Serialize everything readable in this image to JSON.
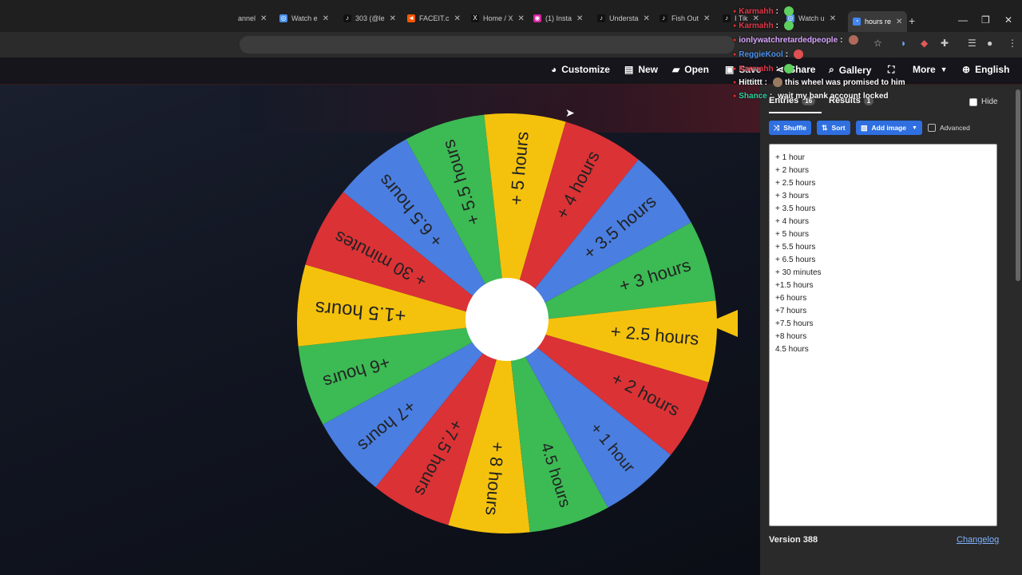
{
  "browser": {
    "tabs": [
      {
        "label": "annel",
        "favicon": "",
        "color": "#888888"
      },
      {
        "label": "Watch e",
        "favicon": "globe",
        "color": "#4a8fe8"
      },
      {
        "label": "303 (@le",
        "favicon": "tiktok",
        "color": "#111111"
      },
      {
        "label": "FACEIT.c",
        "favicon": "faceit",
        "color": "#ff5500"
      },
      {
        "label": "Home / X",
        "favicon": "x",
        "color": "#111111"
      },
      {
        "label": "(1) Insta",
        "favicon": "instagram",
        "color": "#d6249f"
      },
      {
        "label": "Understa",
        "favicon": "tiktok",
        "color": "#111111"
      },
      {
        "label": "Fish Out",
        "favicon": "tiktok",
        "color": "#111111"
      },
      {
        "label": "I Tik",
        "favicon": "tiktok",
        "color": "#111111"
      },
      {
        "label": "Watch u",
        "favicon": "globe",
        "color": "#4a8fe8"
      },
      {
        "label": "hours re",
        "favicon": "wheel",
        "color": "#4285f4",
        "active": true
      }
    ],
    "new_tab": "+",
    "controls": {
      "minimize": "—",
      "maximize": "❐",
      "close": "✕"
    }
  },
  "app_nav": {
    "customize": "Customize",
    "new": "New",
    "open": "Open",
    "save": "Save",
    "share": "Share",
    "gallery": "Gallery",
    "more": "More",
    "language": "English"
  },
  "wheel": {
    "segments": [
      {
        "label": "+ 8 hours",
        "color": "#f4c20d"
      },
      {
        "label": "+7.5 hours",
        "color": "#db3236"
      },
      {
        "label": "+7 hours",
        "color": "#4a7ee0"
      },
      {
        "label": "+6 hours",
        "color": "#3cba54"
      },
      {
        "label": "+1.5 hours",
        "color": "#f4c20d"
      },
      {
        "label": "+ 30 minutes",
        "color": "#db3236"
      },
      {
        "label": "+ 6.5 hours",
        "color": "#4a7ee0"
      },
      {
        "label": "+ 5.5 hours",
        "color": "#3cba54"
      },
      {
        "label": "+ 5 hours",
        "color": "#f4c20d"
      },
      {
        "label": "+ 4 hours",
        "color": "#db3236"
      },
      {
        "label": "+ 3.5 hours",
        "color": "#4a7ee0"
      },
      {
        "label": "+ 3 hours",
        "color": "#3cba54"
      },
      {
        "label": "+ 2.5 hours",
        "color": "#f4c20d"
      },
      {
        "label": "+ 2 hours",
        "color": "#db3236"
      },
      {
        "label": "+ 1 hour",
        "color": "#4a7ee0"
      },
      {
        "label": "4.5 hours",
        "color": "#3cba54"
      }
    ]
  },
  "panel": {
    "tab_entries": "Entries",
    "entries_count": "16",
    "tab_results": "Results",
    "results_count": "1",
    "hide_label": "Hide",
    "shuffle": "Shuffle",
    "sort": "Sort",
    "add_image": "Add image",
    "advanced": "Advanced",
    "entries": [
      "+ 1 hour",
      "+ 2 hours",
      "+ 2.5 hours",
      "+ 3 hours",
      "+ 3.5 hours",
      "+ 4 hours",
      "+ 5 hours",
      "+ 5.5 hours",
      "+ 6.5 hours",
      "+ 30 minutes",
      "+1.5 hours",
      "+6 hours",
      "+7 hours",
      "+7.5 hours",
      "+8 hours",
      "4.5 hours"
    ],
    "version": "Version 388",
    "changelog": "Changelog"
  },
  "chat": [
    {
      "user": "Karmahh",
      "sep": " :",
      "text": "",
      "color": "#e0384a"
    },
    {
      "user": "Karmahh",
      "sep": " :",
      "text": "",
      "color": "#e0384a"
    },
    {
      "user": "ionlywatchretardedpeople",
      "sep": " :",
      "text": "",
      "color": "#d7a5ff"
    },
    {
      "user": "ReggieKool",
      "sep": " :",
      "text": "",
      "color": "#4a8fe8"
    },
    {
      "user": "Karmahh",
      "sep": " :",
      "text": "",
      "color": "#e0384a"
    },
    {
      "user": "Hittittt",
      "sep": " :",
      "text": "this wheel was promised to him",
      "color": "#ffffff"
    },
    {
      "user": "Shance",
      "sep": " :",
      "text": "wait my bank account locked",
      "color": "#2fd0a0"
    }
  ]
}
